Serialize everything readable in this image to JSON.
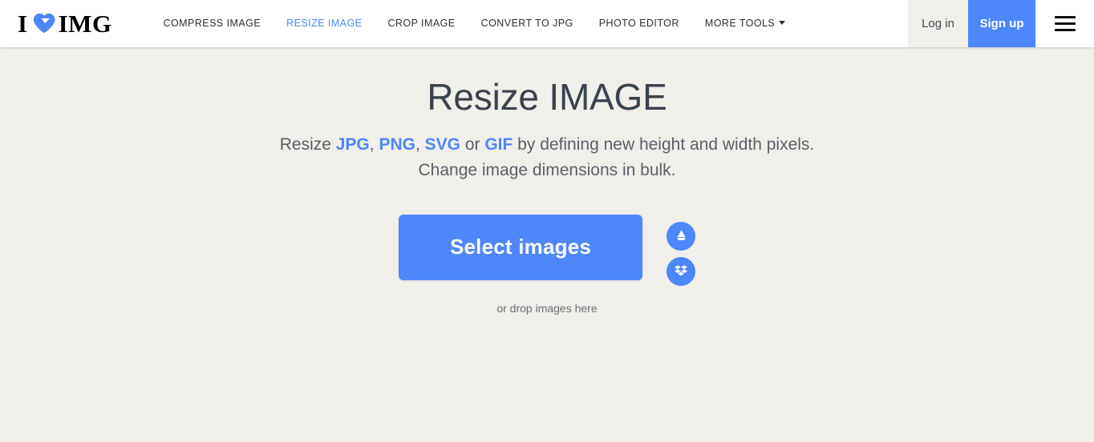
{
  "header": {
    "logo": {
      "left_text": "I",
      "heart_icon": "heart-icon",
      "right_text": "IMG"
    },
    "nav": [
      {
        "label": "COMPRESS IMAGE",
        "active": false
      },
      {
        "label": "RESIZE IMAGE",
        "active": true
      },
      {
        "label": "CROP IMAGE",
        "active": false
      },
      {
        "label": "CONVERT TO JPG",
        "active": false
      },
      {
        "label": "PHOTO EDITOR",
        "active": false
      },
      {
        "label": "MORE TOOLS",
        "active": false,
        "caret": true
      }
    ],
    "login_label": "Log in",
    "signup_label": "Sign up",
    "menu_icon": "hamburger-menu-icon"
  },
  "main": {
    "title": "Resize IMAGE",
    "subtitle_line1": {
      "prefix": "Resize ",
      "format1": "JPG",
      "sep1": ", ",
      "format2": "PNG",
      "sep2": ", ",
      "format3": "SVG",
      "sep3": " or ",
      "format4": "GIF",
      "suffix": " by defining new height and width pixels."
    },
    "subtitle_line2": "Change image dimensions in bulk.",
    "select_button": "Select images",
    "drop_hint": "or drop images here",
    "cloud_buttons": [
      {
        "name": "google-drive-icon",
        "title": "Google Drive"
      },
      {
        "name": "dropbox-icon",
        "title": "Dropbox"
      }
    ]
  },
  "colors": {
    "accent_blue": "#4e86fb",
    "page_background": "#f1efea",
    "header_background": "#ffffff",
    "title_color": "#39424e",
    "subtitle_color": "#5a6069"
  }
}
